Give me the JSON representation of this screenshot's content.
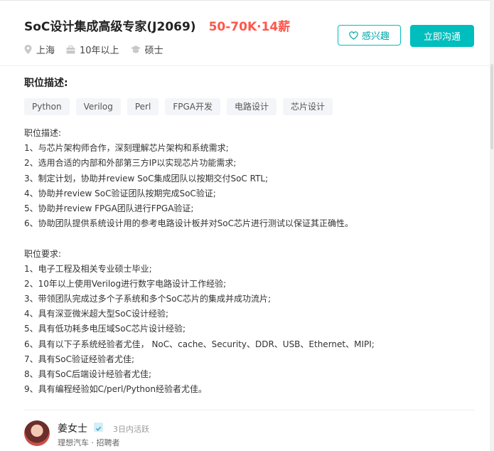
{
  "header": {
    "job_title": "SoC设计集成高级专家(J2069)",
    "salary": "50-70K·14薪",
    "meta": [
      {
        "icon": "location-icon",
        "text": "上海"
      },
      {
        "icon": "briefcase-icon",
        "text": "10年以上"
      },
      {
        "icon": "graduation-cap-icon",
        "text": "硕士"
      }
    ],
    "interest_button": "感兴趣",
    "chat_button": "立即沟通"
  },
  "section": {
    "title": "职位描述:",
    "tags": [
      "Python",
      "Verilog",
      "Perl",
      "FPGA开发",
      "电路设计",
      "芯片设计"
    ]
  },
  "description": [
    "职位描述:",
    "1、与芯片架构师合作，深刻理解芯片架构和系统需求;",
    "2、选用合适的内部和外部第三方IP以实现芯片功能需求;",
    "3、制定计划，协助并review SoC集成团队以按期交付SoC RTL;",
    "4、协助并review SoC验证团队按期完成SoC验证;",
    "5、协助并review FPGA团队进行FPGA验证;",
    "6、协助团队提供系统设计用的参考电路设计板并对SoC芯片进行测试以保证其正确性。",
    "",
    "职位要求:",
    "1、电子工程及相关专业硕士毕业;",
    "2、10年以上使用Verilog进行数字电路设计工作经验;",
    "3、带领团队完成过多个子系统和多个SoC芯片的集成并成功流片;",
    "4、具有深亚微米超大型SoC设计经验;",
    "5、具有低功耗多电压域SoC芯片设计经验;",
    "6、具有以下子系统经验者尤佳， NoC、cache、Security、DDR、USB、Ethernet、MIPI;",
    "7、具有SoC验证经验者尤佳;",
    "8、具有SoC后端设计经验者尤佳;",
    "9、具有编程经验如C/perl/Python经验者尤佳。"
  ],
  "recruiter": {
    "name": "姜女士",
    "active": "3日内活跃",
    "company_line": "理想汽车 · 招聘者"
  },
  "colors": {
    "accent": "#00bebd",
    "salary": "#fe574a"
  }
}
